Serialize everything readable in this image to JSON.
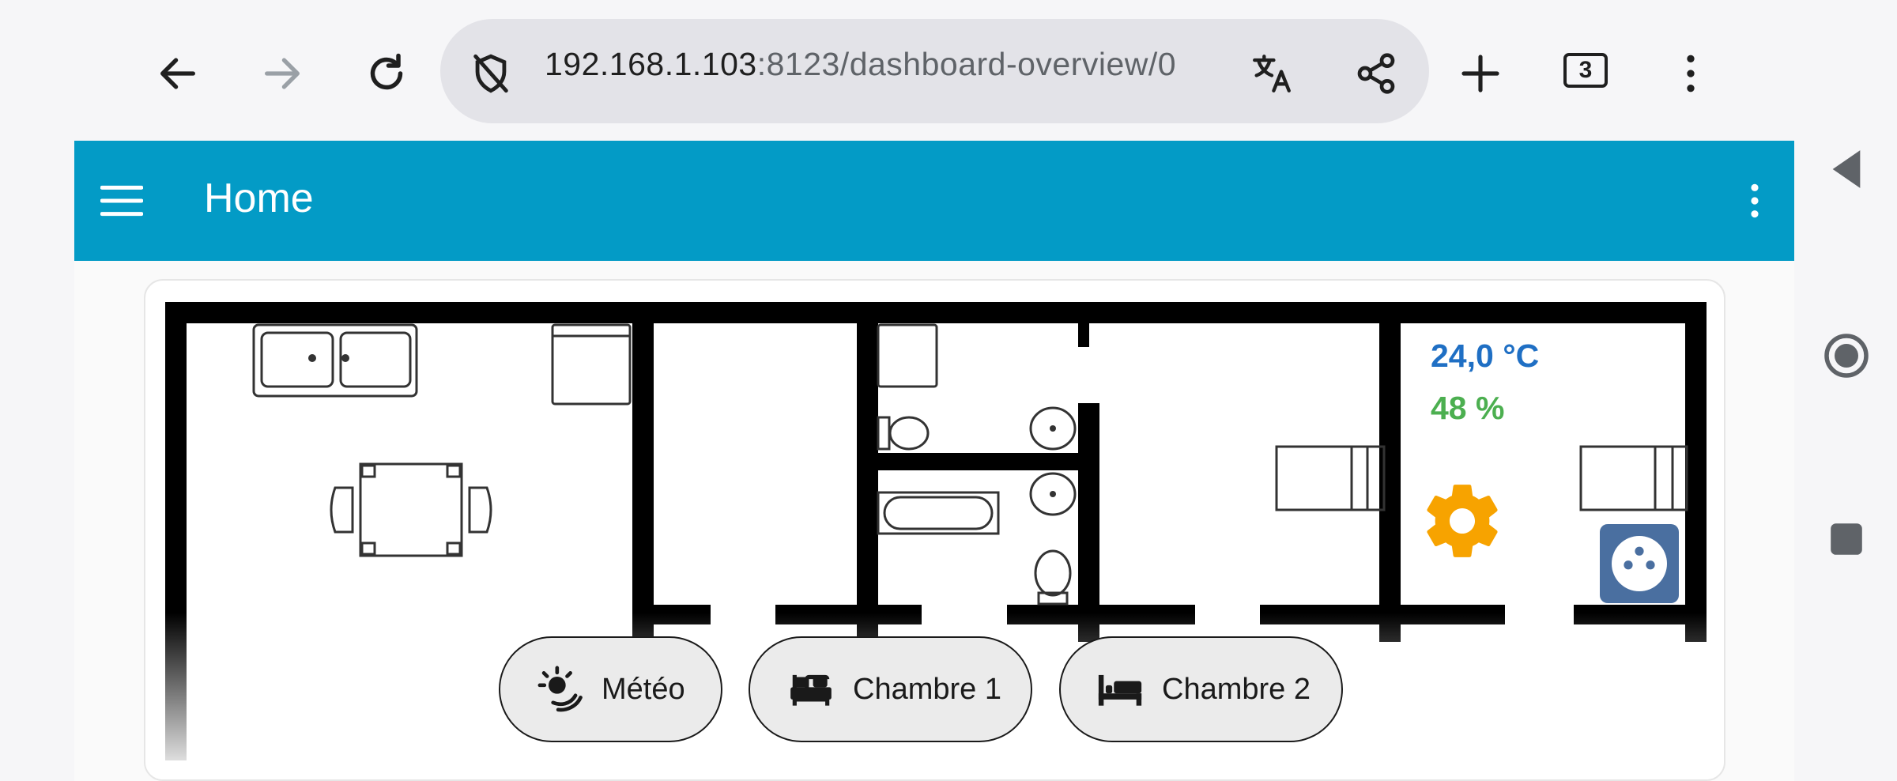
{
  "browser": {
    "url_host": "192.168.1.103",
    "url_path": ":8123/dashboard-overview/0",
    "tab_count": "3",
    "icons": [
      "back-arrow-icon",
      "forward-arrow-icon",
      "reload-icon",
      "shield-slash-icon",
      "translate-icon",
      "share-icon",
      "plus-icon",
      "tabs-icon",
      "kebab-menu-icon"
    ]
  },
  "app": {
    "title": "Home",
    "accent": "#039bc6"
  },
  "floorplan": {
    "temperature": "24,0 °C",
    "humidity": "48 %",
    "temperature_color": "#1f6fc4",
    "humidity_color": "#4caf50",
    "gear_color": "#f7a300",
    "socket_color": "#4a6fa0"
  },
  "chips": [
    {
      "label": "Météo",
      "icon": "weather-icon"
    },
    {
      "label": "Chambre 1",
      "icon": "bed-icon"
    },
    {
      "label": "Chambre 2",
      "icon": "bed-single-icon"
    }
  ]
}
